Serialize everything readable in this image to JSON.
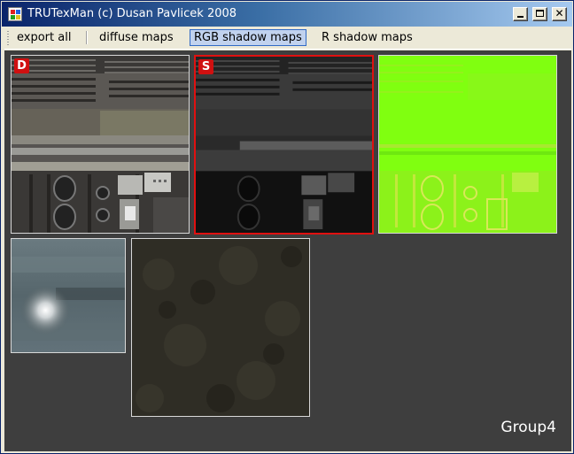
{
  "window": {
    "title": "TRUTexMan (c) Dusan Pavlicek 2008",
    "controls": {
      "minimize": "_",
      "maximize": "□",
      "close": "✕"
    }
  },
  "toolbar": {
    "items": [
      {
        "label": "export all",
        "active": false
      },
      {
        "label": "diffuse maps",
        "active": false
      },
      {
        "label": "RGB shadow maps",
        "active": true
      },
      {
        "label": "R shadow maps",
        "active": false
      }
    ]
  },
  "content": {
    "group_label": "Group4",
    "thumbnails": [
      {
        "kind": "diffuse",
        "badge": "D",
        "selected": false
      },
      {
        "kind": "shadow",
        "badge": "S",
        "selected": true
      },
      {
        "kind": "normal",
        "badge": "",
        "selected": false
      },
      {
        "kind": "blur",
        "badge": "",
        "selected": false
      },
      {
        "kind": "dark-texture",
        "badge": "",
        "selected": false
      }
    ]
  },
  "colors": {
    "background": "#3e3e3e",
    "selection": "#e01010",
    "normal_map": "#80ff10",
    "title_start": "#0a246a",
    "title_end": "#a6caf0"
  }
}
